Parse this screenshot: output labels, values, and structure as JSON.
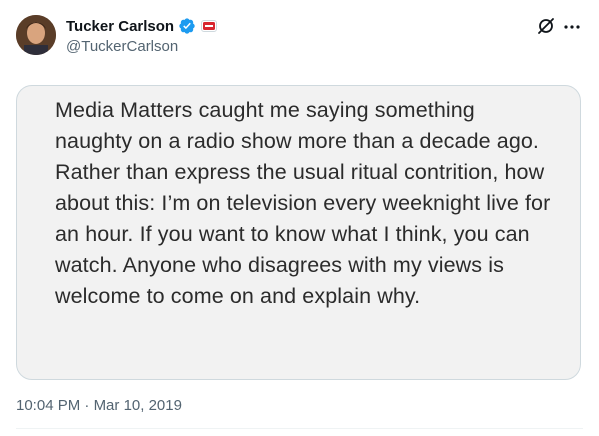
{
  "author": {
    "display_name": "Tucker Carlson",
    "handle": "@TuckerCarlson"
  },
  "tweet": {
    "quote_image_text": "Media Matters caught me saying something naughty on a radio show more than a decade ago. Rather than express the usual ritual contrition, how about this: I’m on television every weeknight live for an hour. If you want to know what I think, you can watch. Anyone who disagrees with my views is welcome to come on and explain why.",
    "time": "10:04 PM",
    "separator": "·",
    "date": "Mar 10, 2019"
  },
  "icons": {
    "verified": "verified-badge-icon",
    "affiliation": "affiliate-badge-icon",
    "grok": "grok-icon",
    "more": "more-options-icon"
  },
  "colors": {
    "verified_blue": "#1d9bf0",
    "text_primary": "#0f1419",
    "text_secondary": "#536471",
    "card_background": "#f2f2f2"
  }
}
